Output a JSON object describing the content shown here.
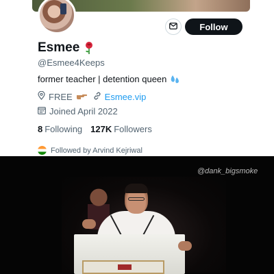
{
  "profile": {
    "display_name": "Esmee",
    "handle": "@Esmee4Keeps",
    "bio": "former teacher | detention queen",
    "location_text": "FREE",
    "link_text": "Esmee.vip",
    "joined_text": "Joined April 2022",
    "following_count": "8",
    "following_label": "Following",
    "followers_count": "127K",
    "followers_label": "Followers",
    "followed_by_text": "Followed by Arvind Kejriwal"
  },
  "actions": {
    "follow_label": "Follow"
  },
  "video": {
    "watermark": "@dank_bigsmoke"
  },
  "icons": {
    "message": "mail-icon",
    "location": "location-pin-icon",
    "link": "link-icon",
    "calendar": "calendar-icon",
    "name_emoji": "rose-icon",
    "bio_emoji": "sweat-drops-icon",
    "location_emoji": "pointing-hand-icon"
  },
  "colors": {
    "accent_link": "#1d9bf0",
    "follow_button": "#0f1419",
    "secondary_text": "#536471"
  }
}
